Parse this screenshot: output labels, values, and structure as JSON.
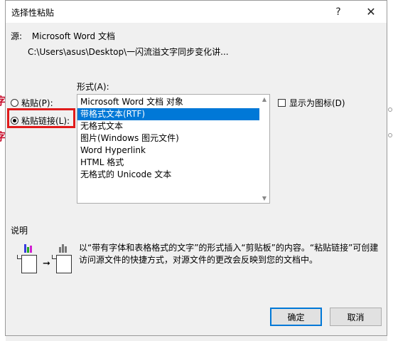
{
  "dialog": {
    "title": "选择性粘贴",
    "help_icon": "?",
    "close_icon": "✕"
  },
  "source": {
    "label": "源:",
    "name": "Microsoft Word 文档",
    "path": "C:\\Users\\asus\\Desktop\\一闪流溢文字同步变化讲..."
  },
  "options": {
    "paste_label": "粘贴(P):",
    "paste_link_label": "粘贴链接(L):",
    "selected": "paste_link",
    "highlight_color": "#e01b1b"
  },
  "format": {
    "label": "形式(A):",
    "items": [
      "Microsoft Word 文档 对象",
      "带格式文本(RTF)",
      "无格式文本",
      "图片(Windows 图元文件)",
      "Word Hyperlink",
      "HTML 格式",
      "无格式的 Unicode 文本"
    ],
    "selected_index": 1,
    "selection_color": "#0078d7"
  },
  "display_as_icon": {
    "label": "显示为图标(D)",
    "checked": false
  },
  "description": {
    "label": "说明",
    "text": "以“带有字体和表格格式的文字”的形式插入“剪贴板”的内容。“粘贴链接”可创建访问源文件的快捷方式，对源文件的更改会反映到您的文档中。"
  },
  "buttons": {
    "ok": "确定",
    "cancel": "取消"
  },
  "background": {
    "left_glyph_1": "字",
    "left_glyph_2": "字"
  }
}
